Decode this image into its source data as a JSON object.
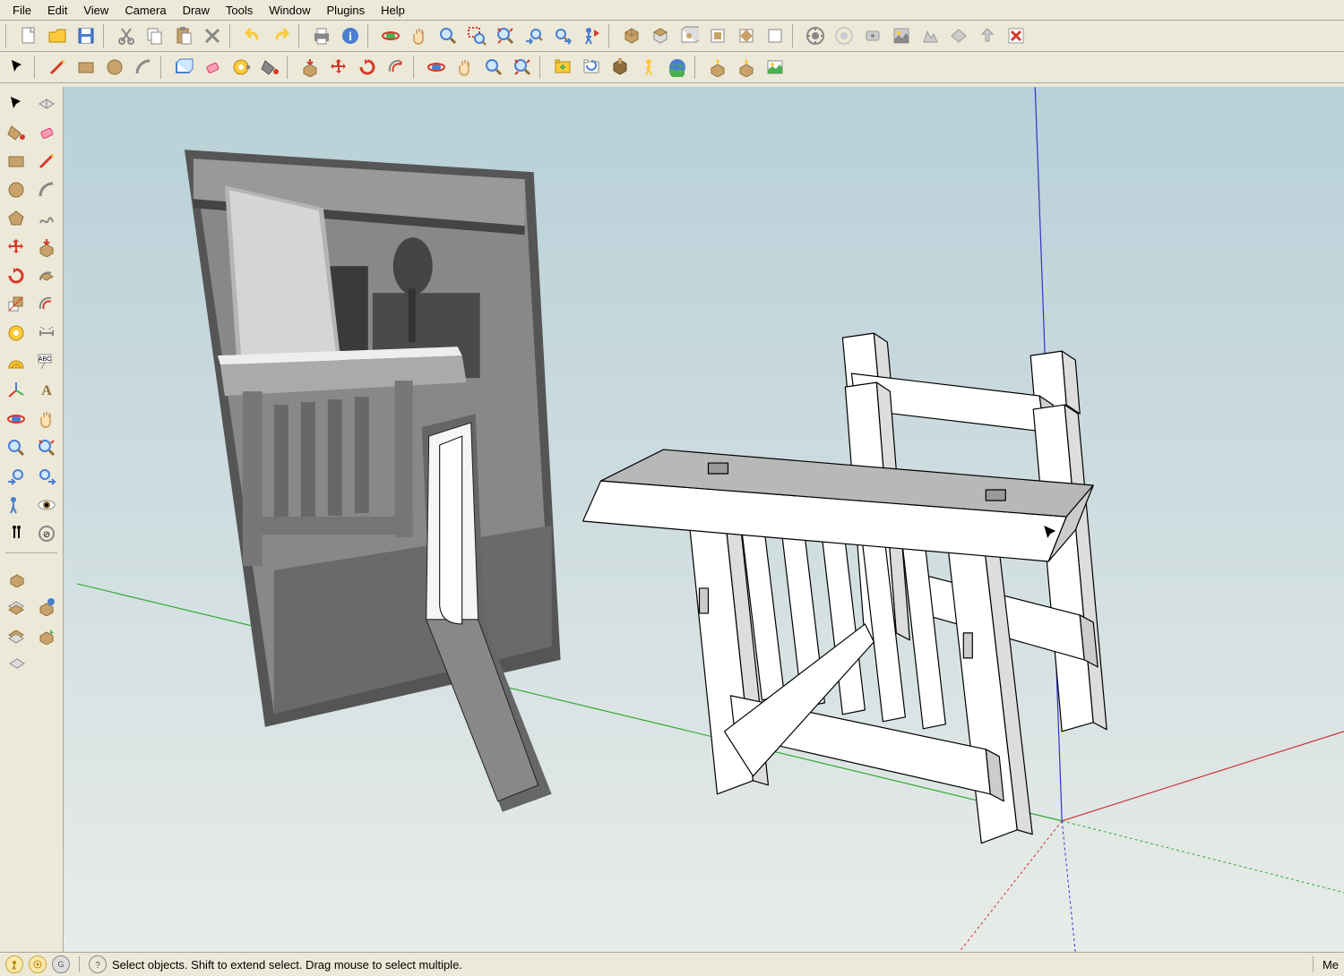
{
  "menu": {
    "items": [
      "File",
      "Edit",
      "View",
      "Camera",
      "Draw",
      "Tools",
      "Window",
      "Plugins",
      "Help"
    ]
  },
  "toolbar1": {
    "icons": [
      "new-icon",
      "open-icon",
      "save-icon",
      "cut-icon",
      "copy-icon",
      "paste-icon",
      "delete-icon",
      "undo-icon",
      "redo-icon",
      "print-icon",
      "model-info-icon",
      "orbit-icon",
      "pan-icon",
      "zoom-icon",
      "zoom-window-icon",
      "zoom-extents-icon",
      "previous-icon",
      "next-icon",
      "position-camera-icon",
      "iso-icon",
      "top-icon",
      "front-icon",
      "right-icon",
      "back-icon",
      "left-icon",
      "get-models-icon",
      "share-model-icon",
      "share-component-icon",
      "toggle-terrain-icon",
      "add-location-icon",
      "preview-icon",
      "export-icon",
      "close-icon"
    ]
  },
  "toolbar2": {
    "icons": [
      "select-icon",
      "line-icon",
      "rectangle-icon",
      "circle-icon",
      "arc-icon",
      "make-component-icon",
      "eraser-icon",
      "tape-icon",
      "paint-bucket-icon",
      "push-pull-icon",
      "move-icon",
      "rotate-icon",
      "offset-icon",
      "orbit2-icon",
      "pan2-icon",
      "zoom2-icon",
      "zoom-extents2-icon",
      "add-scene-icon",
      "update-scene-icon",
      "play-icon",
      "walk-icon",
      "google-earth-icon",
      "share3-icon",
      "upload-icon",
      "get-location-icon"
    ]
  },
  "sidebar": {
    "rows": [
      [
        "select2-icon",
        "section-plane-icon"
      ],
      [
        "paint-bucket2-icon",
        "eraser2-icon"
      ],
      [
        "rectangle2-icon",
        "line2-icon"
      ],
      [
        "circle2-icon",
        "arc2-icon"
      ],
      [
        "polygon-icon",
        "freehand-icon"
      ],
      [
        "move2-icon",
        "push-pull2-icon"
      ],
      [
        "rotate2-icon",
        "follow-me-icon"
      ],
      [
        "scale-icon",
        "offset2-icon"
      ],
      [
        "tape2-icon",
        "dimension-icon"
      ],
      [
        "protractor-icon",
        "text-label-icon"
      ],
      [
        "axes-icon",
        "3d-text-icon"
      ],
      [
        "orbit3-icon",
        "pan3-icon"
      ],
      [
        "zoom3-icon",
        "zoom-extents3-icon"
      ],
      [
        "previous2-icon",
        "next2-icon"
      ],
      [
        "position-camera2-icon",
        "look-around-icon"
      ],
      [
        "walk2-icon",
        "section-display-icon"
      ]
    ],
    "rows2": [
      [
        "outliner-icon",
        ""
      ],
      [
        "component-options-icon",
        "component-attributes-icon"
      ],
      [
        "interact-icon",
        "share4-icon"
      ],
      [
        "toggle-terrain2-icon",
        ""
      ]
    ]
  },
  "status": {
    "hint": "Select objects. Shift to extend select. Drag mouse to select multiple.",
    "right": "Me"
  },
  "colors": {
    "yellow": "#fbca3c",
    "orange": "#e88b00",
    "blue": "#4b7ed1",
    "red": "#d63a2a",
    "green": "#4caf50",
    "purple": "#8e44ad",
    "gray": "#888",
    "brown": "#8d6e63"
  }
}
